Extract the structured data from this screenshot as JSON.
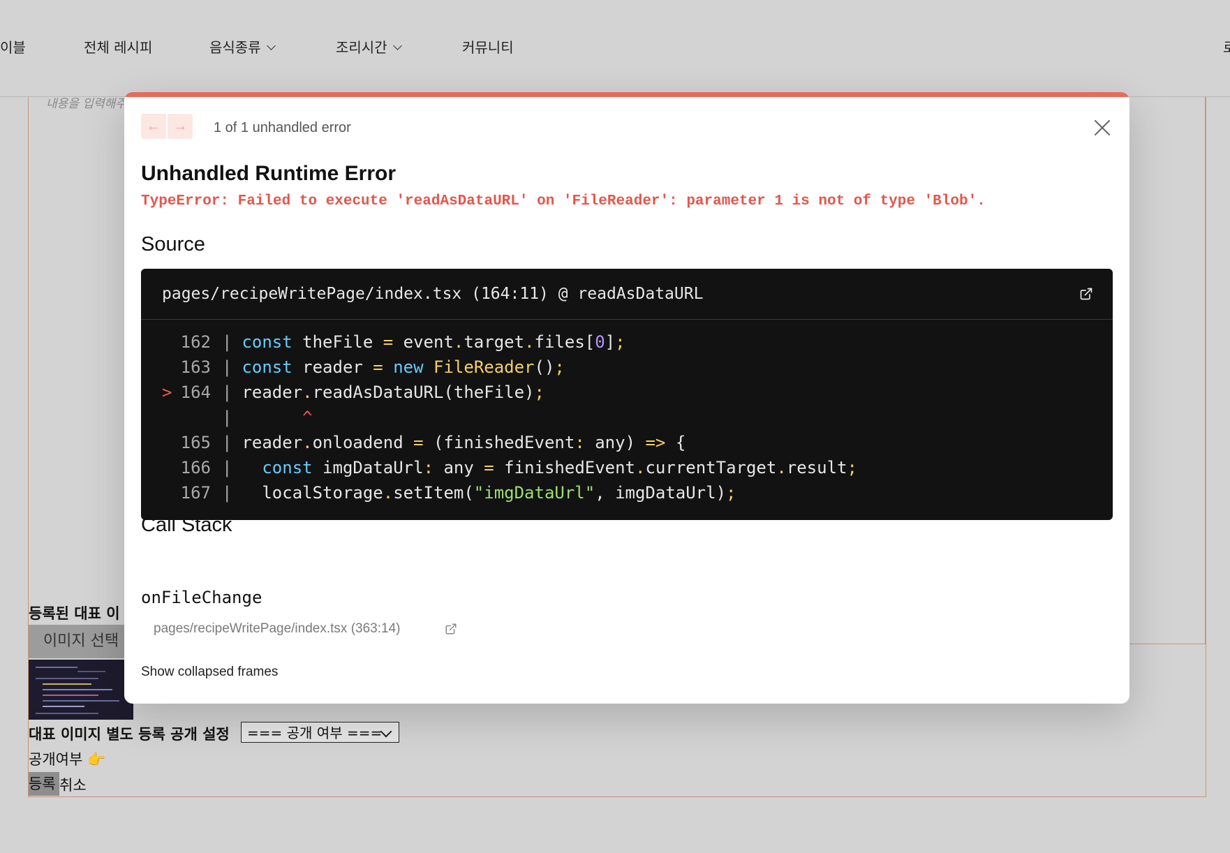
{
  "background": {
    "nav": {
      "items": [
        {
          "label": "이블",
          "has_dropdown": false
        },
        {
          "label": "전체 레시피",
          "has_dropdown": false
        },
        {
          "label": "음식종류",
          "has_dropdown": true
        },
        {
          "label": "조리시간",
          "has_dropdown": true
        },
        {
          "label": "커뮤니티",
          "has_dropdown": false
        }
      ],
      "right_label": "로"
    },
    "editor_placeholder": "내용을 입력해주",
    "registered_image_label": "등록된 대표 이",
    "image_select_button": "이미지 선택",
    "separate_image_label": "대표 이미지 별도 등록 공개 설정",
    "visibility_select": "=== 공개 여부 ===",
    "visibility_label": "공개여부 👉",
    "submit_button": "등록",
    "cancel_button": "취소"
  },
  "modal": {
    "accent_color": "#e66b5b",
    "prev_icon": "arrow-left-icon",
    "next_icon": "arrow-right-icon",
    "error_count": "1 of 1 unhandled error",
    "title": "Unhandled Runtime Error",
    "error_message": "TypeError: Failed to execute 'readAsDataURL' on 'FileReader': parameter 1 is not of type 'Blob'.",
    "source_heading": "Source",
    "source_location": "pages/recipeWritePage/index.tsx (164:11) @ readAsDataURL",
    "code_lines": [
      {
        "num": "162",
        "code": "const theFile = event.target.files[0];"
      },
      {
        "num": "163",
        "code": "const reader = new FileReader();"
      },
      {
        "num": "164",
        "code": "reader.readAsDataURL(theFile);",
        "highlight": true
      },
      {
        "num": "",
        "code": "^"
      },
      {
        "num": "165",
        "code": "reader.onloadend = (finishedEvent: any) => {"
      },
      {
        "num": "166",
        "code": "  const imgDataUrl: any = finishedEvent.currentTarget.result;"
      },
      {
        "num": "167",
        "code": "  localStorage.setItem(\"imgDataUrl\", imgDataUrl);"
      }
    ],
    "highlight_marker": ">",
    "call_stack_heading": "Call Stack",
    "stack_frame_name": "onFileChange",
    "stack_frame_location": "pages/recipeWritePage/index.tsx (363:14)",
    "show_collapsed_label": "Show collapsed frames"
  }
}
